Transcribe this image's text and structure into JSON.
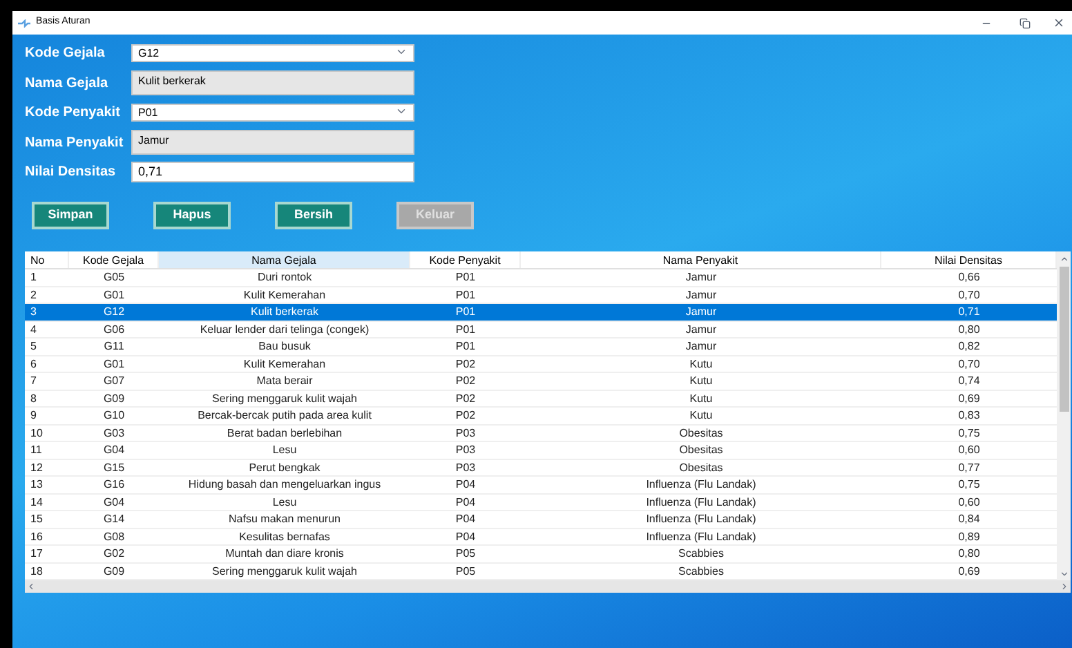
{
  "window": {
    "title": "Basis Aturan"
  },
  "form": [
    {
      "label": "Kode Gejala",
      "kind": "dropdown",
      "value": "G12"
    },
    {
      "label": "Nama Gejala",
      "kind": "readonly",
      "value": "Kulit berkerak"
    },
    {
      "label": "Kode Penyakit",
      "kind": "dropdown",
      "value": "P01"
    },
    {
      "label": "Nama Penyakit",
      "kind": "readonly",
      "value": "Jamur"
    },
    {
      "label": "Nilai Densitas",
      "kind": "text",
      "value": "0,71"
    }
  ],
  "buttons": [
    {
      "label": "Simpan",
      "disabled": false
    },
    {
      "label": "Hapus",
      "disabled": false
    },
    {
      "label": "Bersih",
      "disabled": false
    },
    {
      "label": "Keluar",
      "disabled": true
    }
  ],
  "table": {
    "columns": [
      {
        "label": "No",
        "highlighted": false
      },
      {
        "label": "Kode Gejala",
        "highlighted": false
      },
      {
        "label": "Nama Gejala",
        "highlighted": true
      },
      {
        "label": "Kode Penyakit",
        "highlighted": false
      },
      {
        "label": "Nama Penyakit",
        "highlighted": false
      },
      {
        "label": "Nilai Densitas",
        "highlighted": false
      }
    ],
    "rows": [
      {
        "cells": [
          "1",
          "G05",
          "Duri rontok",
          "P01",
          "Jamur",
          "0,66"
        ],
        "selected": false
      },
      {
        "cells": [
          "2",
          "G01",
          "Kulit Kemerahan",
          "P01",
          "Jamur",
          "0,70"
        ],
        "selected": false
      },
      {
        "cells": [
          "3",
          "G12",
          "Kulit berkerak",
          "P01",
          "Jamur",
          "0,71"
        ],
        "selected": true
      },
      {
        "cells": [
          "4",
          "G06",
          "Keluar lender dari telinga (congek)",
          "P01",
          "Jamur",
          "0,80"
        ],
        "selected": false
      },
      {
        "cells": [
          "5",
          "G11",
          "Bau busuk",
          "P01",
          "Jamur",
          "0,82"
        ],
        "selected": false
      },
      {
        "cells": [
          "6",
          "G01",
          "Kulit Kemerahan",
          "P02",
          "Kutu",
          "0,70"
        ],
        "selected": false
      },
      {
        "cells": [
          "7",
          "G07",
          "Mata berair",
          "P02",
          "Kutu",
          "0,74"
        ],
        "selected": false
      },
      {
        "cells": [
          "8",
          "G09",
          "Sering menggaruk kulit wajah",
          "P02",
          "Kutu",
          "0,69"
        ],
        "selected": false
      },
      {
        "cells": [
          "9",
          "G10",
          "Bercak-bercak putih pada area kulit",
          "P02",
          "Kutu",
          "0,83"
        ],
        "selected": false
      },
      {
        "cells": [
          "10",
          "G03",
          "Berat badan berlebihan",
          "P03",
          "Obesitas",
          "0,75"
        ],
        "selected": false
      },
      {
        "cells": [
          "11",
          "G04",
          "Lesu",
          "P03",
          "Obesitas",
          "0,60"
        ],
        "selected": false
      },
      {
        "cells": [
          "12",
          "G15",
          "Perut bengkak",
          "P03",
          "Obesitas",
          "0,77"
        ],
        "selected": false
      },
      {
        "cells": [
          "13",
          "G16",
          "Hidung basah dan mengeluarkan ingus",
          "P04",
          "Influenza (Flu Landak)",
          "0,75"
        ],
        "selected": false
      },
      {
        "cells": [
          "14",
          "G04",
          "Lesu",
          "P04",
          "Influenza (Flu Landak)",
          "0,60"
        ],
        "selected": false
      },
      {
        "cells": [
          "15",
          "G14",
          "Nafsu makan menurun",
          "P04",
          "Influenza (Flu Landak)",
          "0,84"
        ],
        "selected": false
      },
      {
        "cells": [
          "16",
          "G08",
          "Kesulitas bernafas",
          "P04",
          "Influenza (Flu Landak)",
          "0,89"
        ],
        "selected": false
      },
      {
        "cells": [
          "17",
          "G02",
          "Muntah dan diare kronis",
          "P05",
          "Scabbies",
          "0,80"
        ],
        "selected": false
      },
      {
        "cells": [
          "18",
          "G09",
          "Sering menggaruk kulit wajah",
          "P05",
          "Scabbies",
          "0,69"
        ],
        "selected": false
      }
    ]
  }
}
